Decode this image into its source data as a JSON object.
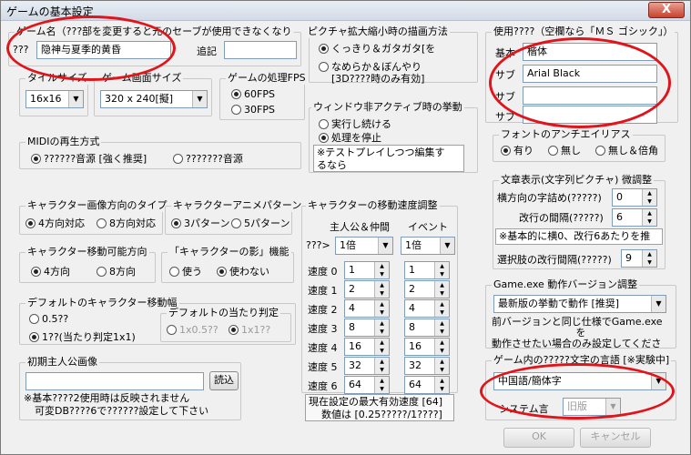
{
  "window": {
    "title": "ゲームの基本設定",
    "close_label": "X"
  },
  "game_name": {
    "legend": "ゲーム名（???部を変更すると元のセーブが使用できなくなり",
    "prefix": "???",
    "value": "隐神与夏季的黄昏",
    "append_label": "追記",
    "append_value": ""
  },
  "picture_scale": {
    "legend": "ピクチャ拡大縮小時の描画方法",
    "opt1": "くっきり＆ガタガタ[を",
    "opt2a": "なめらか＆ぼんやり",
    "opt2b": "[3D????時のみ有効]"
  },
  "tile_size": {
    "legend": "タイルサイズ",
    "value": "16x16"
  },
  "screen_size": {
    "legend": "ゲーム画面サイズ",
    "value": "320 x 240[擬]"
  },
  "fps": {
    "legend": "ゲームの処理FPS",
    "opt1": "60FPS",
    "opt2": "30FPS"
  },
  "inactive": {
    "legend": "ウィンドウ非アクティブ時の挙動",
    "opt1": "実行し続ける",
    "opt2": "処理を停止",
    "note1": "※テストプレイしつつ編集す",
    "note2": "るなら"
  },
  "midi": {
    "legend": "MIDIの再生方式",
    "opt1": "??????音源 [強く推奨]",
    "opt2": "???????音源"
  },
  "font": {
    "legend": "使用????（空欄なら「ＭＳ ゴシック」）",
    "basic_label": "基本",
    "basic_value": "楷体",
    "sub1_label": "サブ",
    "sub1_value": "Arial Black",
    "sub2_label": "サブ",
    "sub2_value": "",
    "sub3_label": "サブ",
    "sub3_value": ""
  },
  "antialias": {
    "legend": "フォントのアンチエイリアス",
    "opt1": "有り",
    "opt2": "無し",
    "opt3": "無し＆倍角"
  },
  "text_display": {
    "legend": "文章表示(文字列ピクチャ) 微調整",
    "h_spacing_label": "横方向の字詰め(?????)",
    "h_spacing_value": "0",
    "line_spacing_label": "改行の間隔(?????)",
    "line_spacing_value": "6",
    "note": "※基本的に横0、改行6あたりを推",
    "choice_label": "選択肢の改行間隔(?????)",
    "choice_value": "9"
  },
  "char_dir": {
    "legend": "キャラクター画像方向のタイプ",
    "opt1": "4方向対応",
    "opt2": "8方向対応"
  },
  "char_anim": {
    "legend": "キャラクターアニメパターン",
    "opt1": "3パターン",
    "opt2": "5パターン"
  },
  "move_speed": {
    "legend": "キャラクターの移動速度調整",
    "col1": "主人公＆仲間",
    "col2": "イベント",
    "row_label": "???>",
    "sel1": "1倍",
    "sel2": "1倍",
    "rows": [
      {
        "label": "速度 0",
        "v1": "1",
        "v2": "1"
      },
      {
        "label": "速度 1",
        "v1": "2",
        "v2": "2"
      },
      {
        "label": "速度 2",
        "v1": "4",
        "v2": "4"
      },
      {
        "label": "速度 3",
        "v1": "8",
        "v2": "8"
      },
      {
        "label": "速度 4",
        "v1": "16",
        "v2": "16"
      },
      {
        "label": "速度 5",
        "v1": "32",
        "v2": "32"
      },
      {
        "label": "速度 6",
        "v1": "64",
        "v2": "64"
      }
    ],
    "note1": "現在設定の最大有効速度 [64]",
    "note2": "数値は [0.25?????/1????]"
  },
  "char_move": {
    "legend": "キャラクター移動可能方向",
    "opt1": "4方向",
    "opt2": "8方向"
  },
  "char_shadow": {
    "legend": "「キャラクターの影」機能",
    "opt1": "使う",
    "opt2": "使わない"
  },
  "default_size": {
    "legend": "デフォルトのキャラクター移動幅",
    "opt1": "0.5??",
    "opt2": "1??(当たり判定1x1)",
    "hit_legend": "デフォルトの当たり判定",
    "hit1": "1x0.5??",
    "hit2": "1x1??"
  },
  "initial_image": {
    "legend": "初期主人公画像",
    "load": "読込",
    "note1": "※基本????2使用時は反映されません",
    "note2": "可変DB????6で??????設定して下さい"
  },
  "game_exe": {
    "legend": "Game.exe 動作バージョン調整",
    "value": "最新版の挙動で動作 [推奨]",
    "note1": "前バージョンと同じ仕様でGame.exe",
    "note2": "を",
    "note3": "動作させたい場合のみ設定してくださ"
  },
  "language": {
    "legend": "ゲーム内の?????文字の言語 [※実験中]",
    "value": "中国語/簡体字",
    "sys_label": "システム言",
    "sys_value": "旧版"
  },
  "buttons": {
    "ok": "OK",
    "cancel": "キャンセル"
  }
}
